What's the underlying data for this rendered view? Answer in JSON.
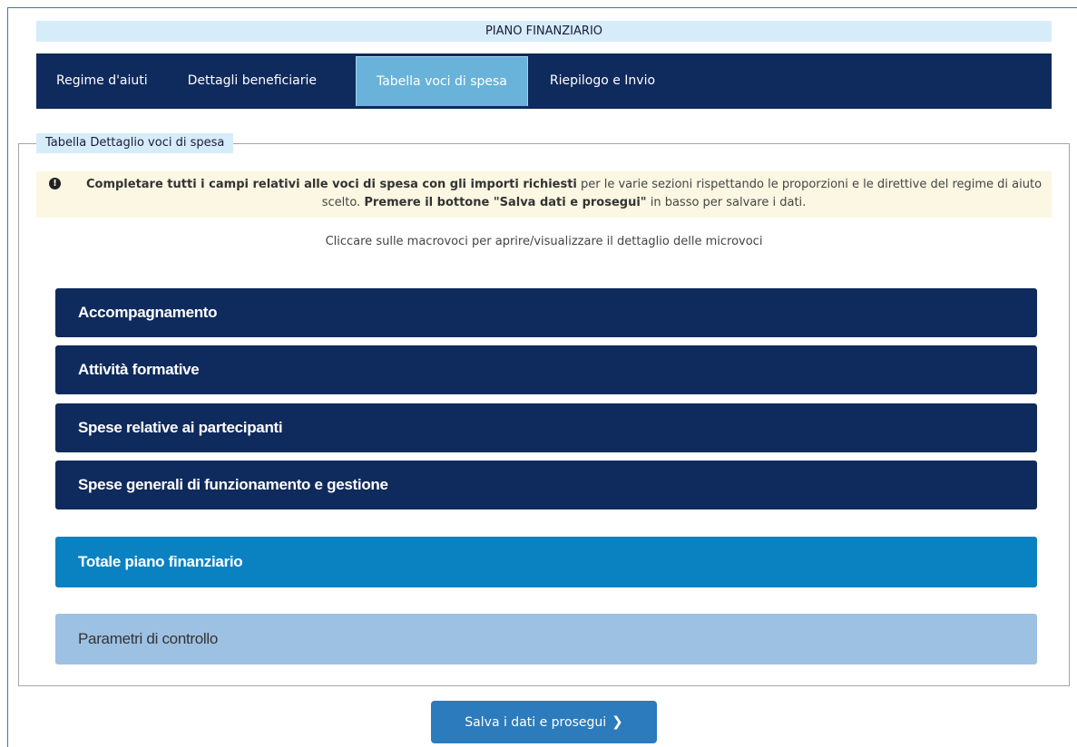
{
  "header": {
    "title": "PIANO FINANZIARIO"
  },
  "tabs": [
    {
      "label": "Regime d'aiuti",
      "active": false
    },
    {
      "label": "Dettagli beneficiarie",
      "active": false
    },
    {
      "label": "Tabella voci di spesa",
      "active": true
    },
    {
      "label": "Riepilogo e Invio",
      "active": false
    }
  ],
  "section": {
    "legend": "Tabella Dettaglio voci di spesa",
    "notice": {
      "icon": "exclamation-circle-icon",
      "bold1": "Completare tutti i campi relativi alle voci di spesa con gli importi richiesti",
      "text1": " per le varie sezioni rispettando le proporzioni e le direttive del regime di aiuto scelto. ",
      "bold2": "Premere il bottone \"Salva dati e prosegui\"",
      "text2": " in basso per salvare i dati."
    },
    "hint": "Cliccare sulle macrovoci per aprire/visualizzare il dettaglio delle microvoci",
    "macrovoci": [
      {
        "label": "Accompagnamento"
      },
      {
        "label": "Attività formative"
      },
      {
        "label": "Spese relative ai partecipanti"
      },
      {
        "label": "Spese generali di funzionamento e gestione"
      }
    ],
    "totale": "Totale piano finanziario",
    "parametri": "Parametri di controllo"
  },
  "actions": {
    "save_label": "Salva i dati e prosegui",
    "save_icon": "chevron-right-icon"
  },
  "colors": {
    "navy": "#0f2a5c",
    "active_tab": "#69b2d9",
    "total": "#0a82c2",
    "params": "#9dc1e3",
    "button": "#2c7bbc"
  }
}
